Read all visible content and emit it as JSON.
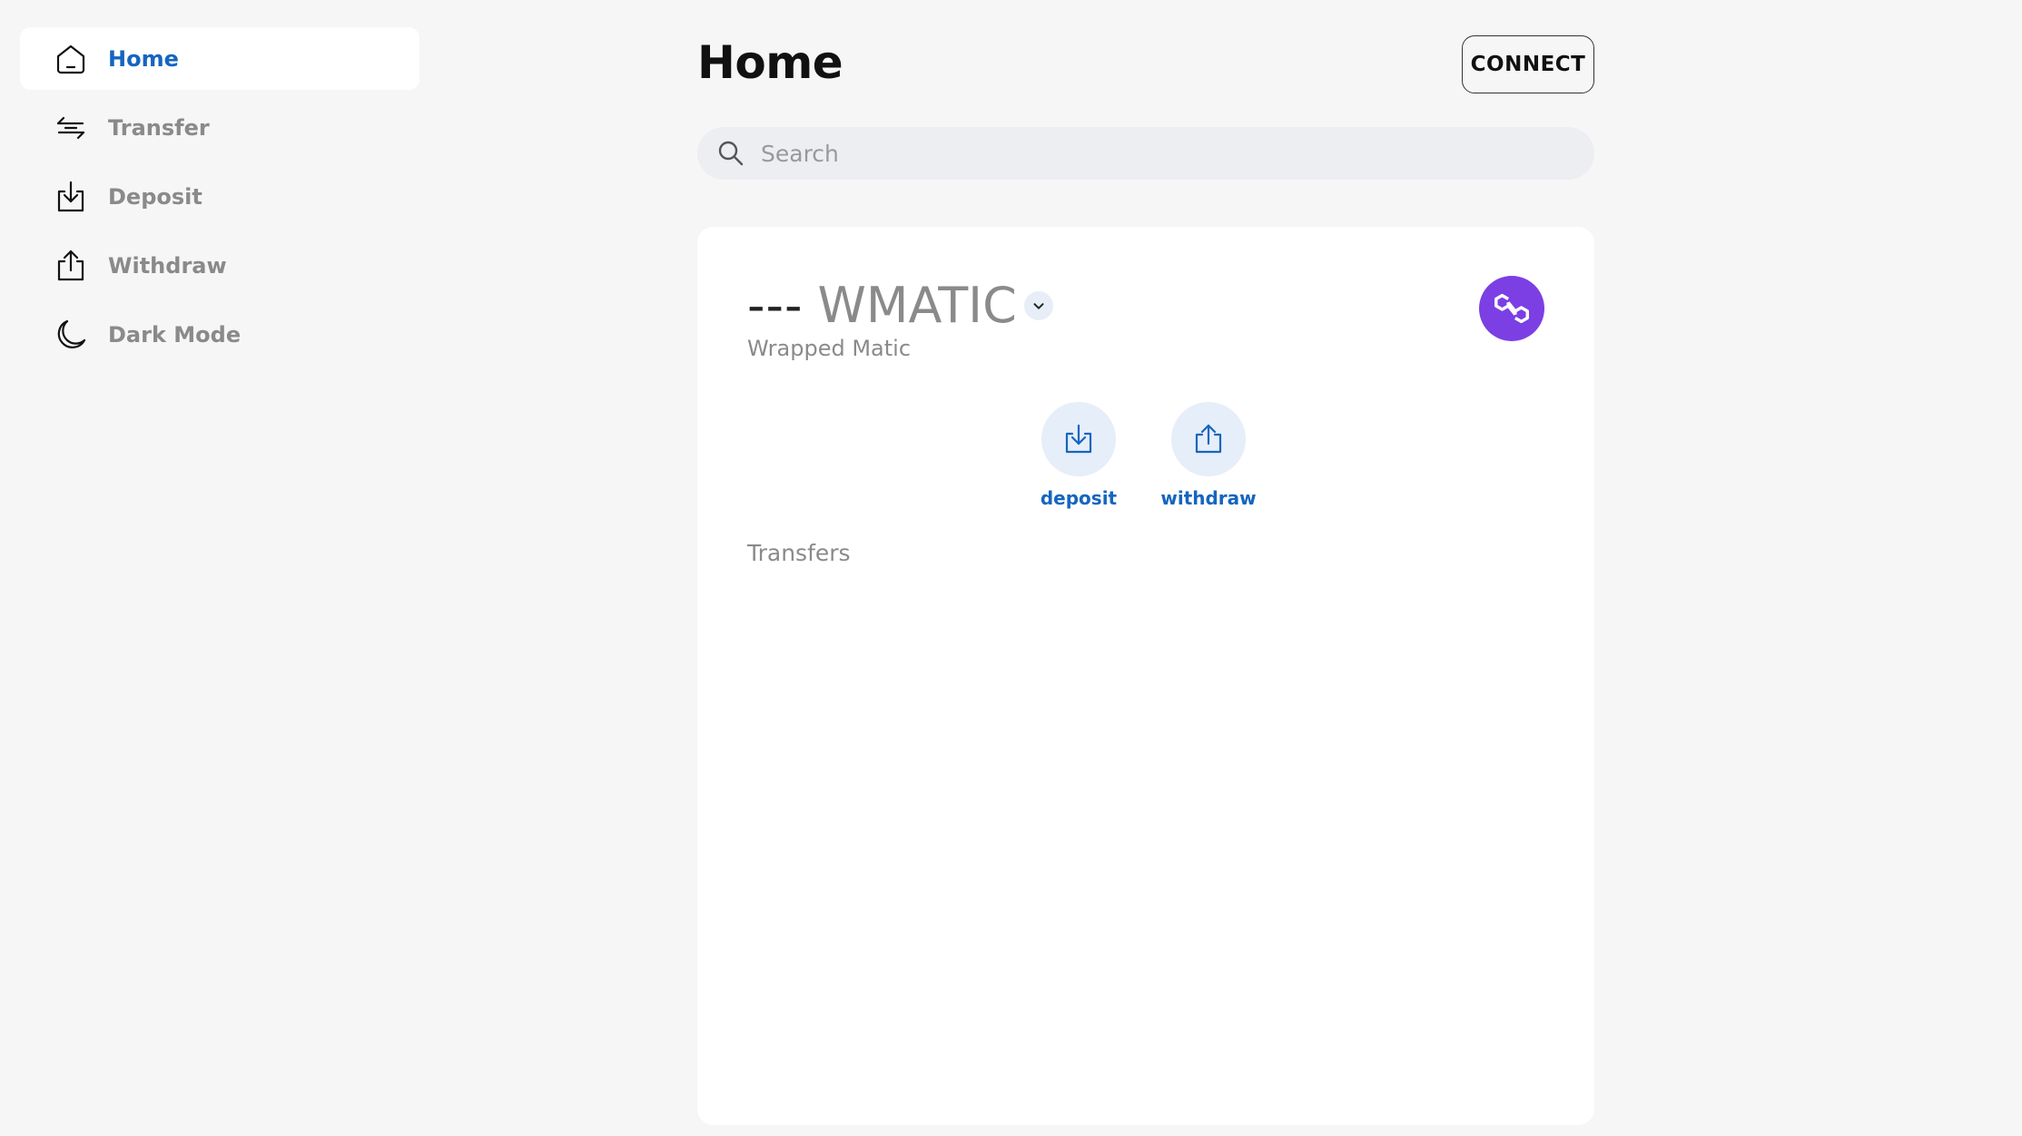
{
  "sidebar": {
    "items": [
      {
        "label": "Home",
        "icon": "home-icon",
        "active": true
      },
      {
        "label": "Transfer",
        "icon": "transfer-arrows-icon"
      },
      {
        "label": "Deposit",
        "icon": "deposit-icon"
      },
      {
        "label": "Withdraw",
        "icon": "withdraw-icon"
      },
      {
        "label": "Dark Mode",
        "icon": "moon-icon"
      }
    ]
  },
  "header": {
    "title": "Home",
    "connect_label": "CONNECT"
  },
  "search": {
    "placeholder": "Search",
    "value": ""
  },
  "token": {
    "balance": "---",
    "symbol": "WMATIC",
    "name": "Wrapped Matic",
    "logo_icon": "polygon-logo-icon"
  },
  "actions": {
    "deposit_label": "deposit",
    "withdraw_label": "withdraw"
  },
  "transfers": {
    "title": "Transfers",
    "items": []
  },
  "colors": {
    "accent": "#1565c0",
    "background": "#f6f6f6",
    "polygon_purple": "#7b3fe4",
    "muted_text": "#8a8a8a"
  }
}
